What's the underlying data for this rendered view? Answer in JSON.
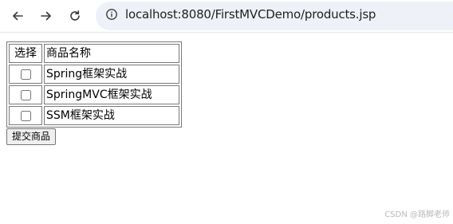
{
  "browser": {
    "url": "localhost:8080/FirstMVCDemo/products.jsp",
    "icons": {
      "back": "arrow-left-icon",
      "forward": "arrow-right-icon",
      "reload": "reload-icon",
      "site_info": "info-icon"
    }
  },
  "table": {
    "headers": [
      "选择",
      "商品名称"
    ],
    "rows": [
      {
        "name": "Spring框架实战",
        "checked": false
      },
      {
        "name": "SpringMVC框架实战",
        "checked": false
      },
      {
        "name": "SSM框架实战",
        "checked": false
      }
    ]
  },
  "form": {
    "submit_label": "提交商品"
  },
  "watermark": "CSDN @路脚老师"
}
